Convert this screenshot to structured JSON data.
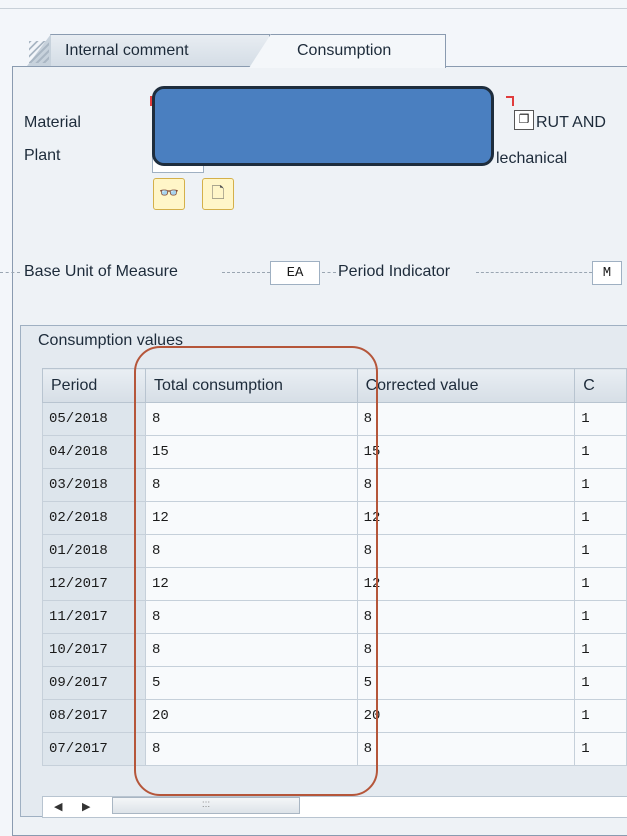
{
  "tabs": [
    {
      "label": "Internal comment"
    },
    {
      "label": "Consumption"
    }
  ],
  "header": {
    "material_label": "Material",
    "material_text": "RUT AND",
    "plant_label": "Plant",
    "plant_text": "lechanical"
  },
  "units": {
    "base_uom_label": "Base Unit of Measure",
    "base_uom_value": "EA",
    "period_indicator_label": "Period Indicator",
    "period_indicator_value": "M"
  },
  "consumption": {
    "title": "Consumption values",
    "columns": [
      "Period",
      "Total consumption",
      "Corrected value",
      "C"
    ],
    "rows": [
      {
        "period": "05/2018",
        "total": "8",
        "corrected": "8",
        "next": "1"
      },
      {
        "period": "04/2018",
        "total": "15",
        "corrected": "15",
        "next": "1"
      },
      {
        "period": "03/2018",
        "total": "8",
        "corrected": "8",
        "next": "1"
      },
      {
        "period": "02/2018",
        "total": "12",
        "corrected": "12",
        "next": "1"
      },
      {
        "period": "01/2018",
        "total": "8",
        "corrected": "8",
        "next": "1"
      },
      {
        "period": "12/2017",
        "total": "12",
        "corrected": "12",
        "next": "1"
      },
      {
        "period": "11/2017",
        "total": "8",
        "corrected": "8",
        "next": "1"
      },
      {
        "period": "10/2017",
        "total": "8",
        "corrected": "8",
        "next": "1"
      },
      {
        "period": "09/2017",
        "total": "5",
        "corrected": "5",
        "next": "1"
      },
      {
        "period": "08/2017",
        "total": "20",
        "corrected": "20",
        "next": "1"
      },
      {
        "period": "07/2017",
        "total": "8",
        "corrected": "8",
        "next": "1"
      }
    ]
  },
  "scrollbar": {
    "left_arrow": "◀",
    "right_arrow": "▶",
    "grip": ":::"
  },
  "colors": {
    "highlight": "#b5563a",
    "redaction": "#4a7fc0"
  }
}
